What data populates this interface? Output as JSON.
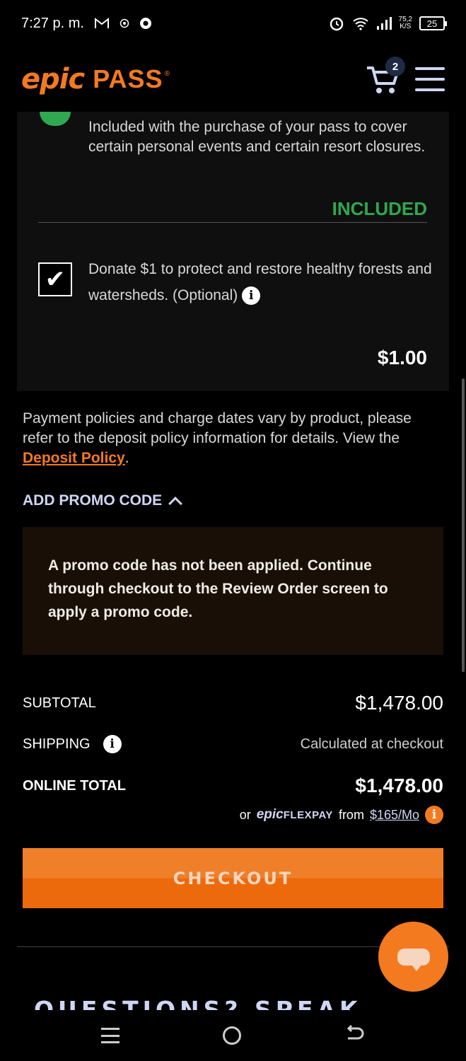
{
  "status_bar": {
    "time": "7:27 p. m.",
    "net_speed_value": "75,2",
    "net_speed_unit": "K/S",
    "battery": "25"
  },
  "header": {
    "logo_epic": "epic",
    "logo_pass": "PASS",
    "logo_reg": "®",
    "cart_count": "2"
  },
  "coverage": {
    "description": "Included with the purchase of your pass to cover certain personal events and certain resort closures.",
    "status": "INCLUDED"
  },
  "donation": {
    "checked_mark": "✔",
    "label": "Donate $1 to protect and restore healthy forests and watersheds. (Optional)",
    "price": "$1.00"
  },
  "policy": {
    "text": "Payment policies and charge dates vary by product, please refer to the deposit policy information for details. View the ",
    "link": "Deposit Policy",
    "end": "."
  },
  "promo": {
    "toggle_label": "ADD PROMO CODE",
    "message": "A promo code has not been applied. Continue through checkout to the Review Order screen to apply a promo code."
  },
  "totals": {
    "subtotal_label": "SUBTOTAL",
    "subtotal_value": "$1,478.00",
    "shipping_label": "SHIPPING",
    "shipping_value": "Calculated at checkout",
    "online_total_label": "ONLINE TOTAL",
    "online_total_value": "$1,478.00",
    "flexpay_prefix": "or",
    "flexpay_logo_epic": "epic",
    "flexpay_logo_word": "FLEXPAY",
    "flexpay_from": "from",
    "flexpay_amount": "$165/Mo"
  },
  "checkout_label": "CHECKOUT",
  "questions_heading": "QUESTIONS? SPEAK TO A",
  "icons": {
    "info": "i"
  },
  "colors": {
    "accent_orange": "#f47a20",
    "included_green": "#2fa84f",
    "link_lavender": "#cfd6f5"
  }
}
